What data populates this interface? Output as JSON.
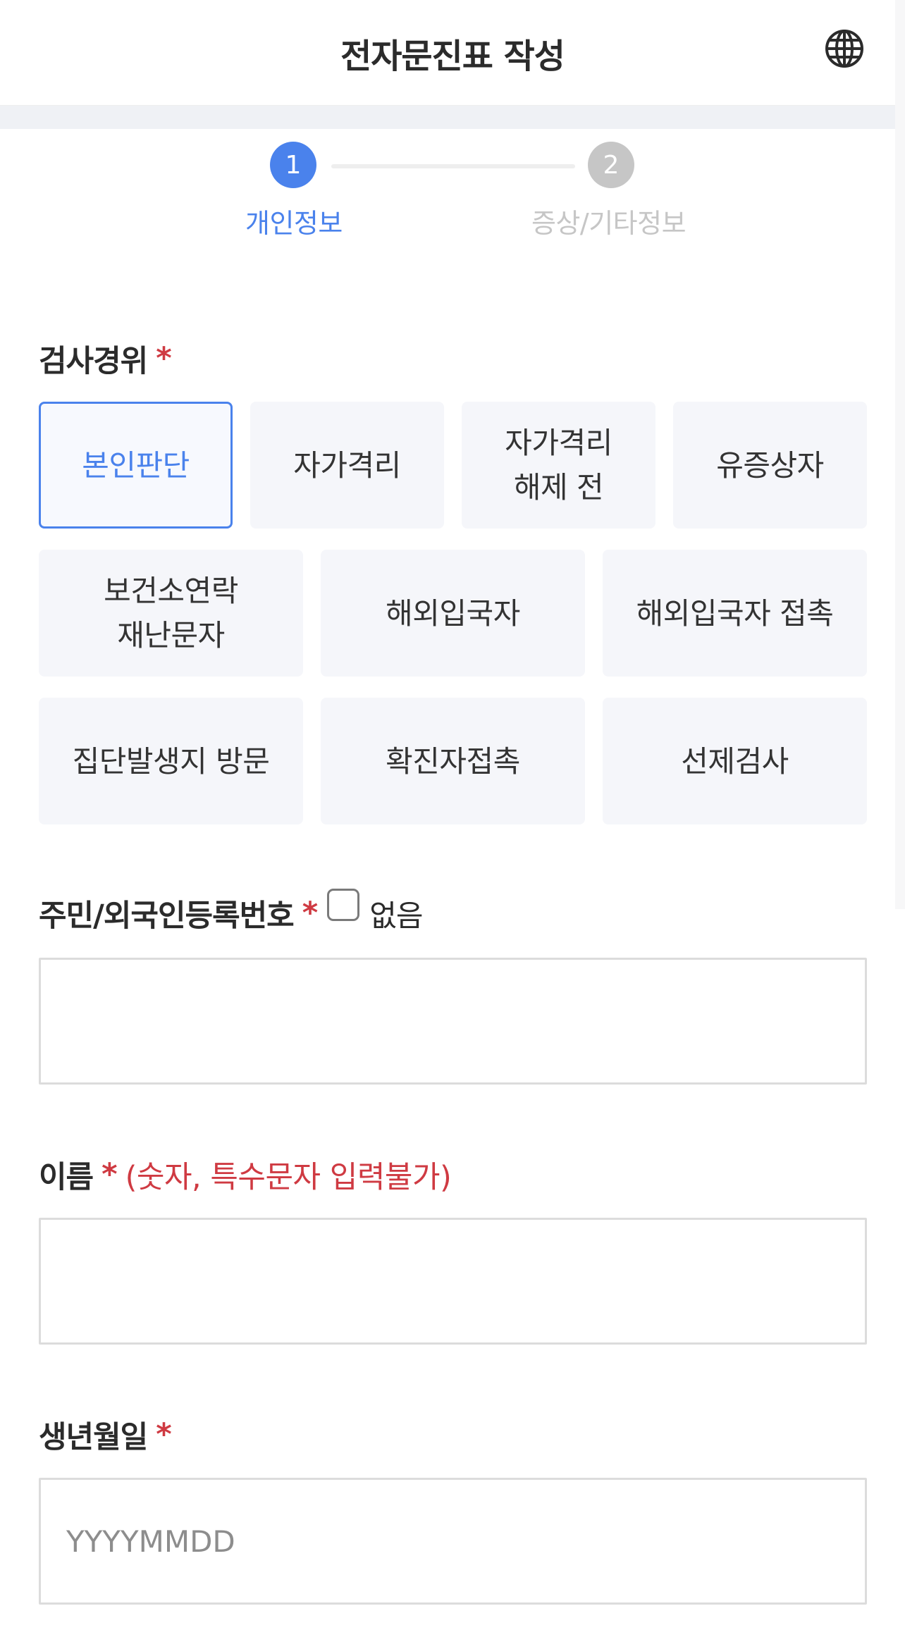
{
  "header": {
    "title": "전자문진표 작성",
    "language_icon": "globe-icon"
  },
  "stepper": {
    "steps": [
      {
        "number": "1",
        "label": "개인정보",
        "active": true
      },
      {
        "number": "2",
        "label": "증상/기타정보",
        "active": false
      }
    ]
  },
  "exam_reason": {
    "label": "검사경위",
    "required_mark": "*",
    "selected": "본인판단",
    "options": [
      "본인판단",
      "자가격리",
      "자가격리\n해제 전",
      "유증상자",
      "보건소연락\n재난문자",
      "해외입국자",
      "해외입국자 접촉",
      "집단발생지 방문",
      "확진자접촉",
      "선제검사"
    ]
  },
  "resident_number": {
    "label": "주민/외국인등록번호",
    "required_mark": "*",
    "none_checkbox_label": "없음",
    "none_checked": false,
    "value": "",
    "placeholder": ""
  },
  "name": {
    "label": "이름",
    "required_mark": "*",
    "hint": "(숫자, 특수문자 입력불가)",
    "value": "",
    "placeholder": ""
  },
  "birthdate": {
    "label": "생년월일",
    "required_mark": "*",
    "value": "",
    "placeholder": "YYYYMMDD"
  },
  "colors": {
    "accent": "#4a82ec",
    "required": "#cf3a42",
    "inactive_step": "#c6c6c6",
    "option_bg": "#f5f6fa"
  }
}
